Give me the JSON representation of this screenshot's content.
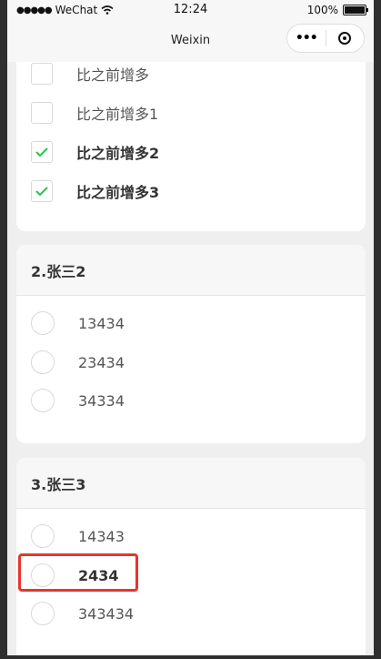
{
  "status_bar": {
    "carrier": "WeChat",
    "time": "12:24",
    "battery": "100%"
  },
  "nav": {
    "title": "Weixin",
    "menu_glyph": "•••"
  },
  "question1": {
    "options": [
      {
        "label": "比之前增多",
        "checked": false
      },
      {
        "label": "比之前增多1",
        "checked": false
      },
      {
        "label": "比之前增多2",
        "checked": true
      },
      {
        "label": "比之前增多3",
        "checked": true
      }
    ]
  },
  "question2": {
    "title": "2.张三2",
    "options": [
      {
        "label": "13434"
      },
      {
        "label": "23434"
      },
      {
        "label": "34334"
      }
    ]
  },
  "question3": {
    "title": "3.张三3",
    "options": [
      {
        "label": "14343"
      },
      {
        "label": "2434"
      },
      {
        "label": "343434"
      }
    ]
  },
  "colors": {
    "check_green": "#2bc24a",
    "highlight_red": "#e8342b"
  }
}
